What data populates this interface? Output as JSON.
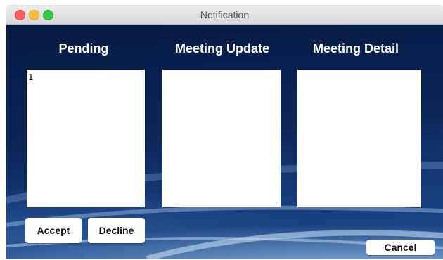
{
  "window": {
    "title": "Notification"
  },
  "columns": {
    "pending": {
      "heading": "Pending",
      "items": [
        "1"
      ]
    },
    "meeting_update": {
      "heading": "Meeting Update"
    },
    "meeting_detail": {
      "heading": "Meeting Detail"
    }
  },
  "buttons": {
    "accept": "Accept",
    "decline": "Decline",
    "cancel": "Cancel"
  },
  "colors": {
    "close": "#fc605c",
    "minimize": "#fdbc40",
    "maximize": "#34c84a"
  }
}
